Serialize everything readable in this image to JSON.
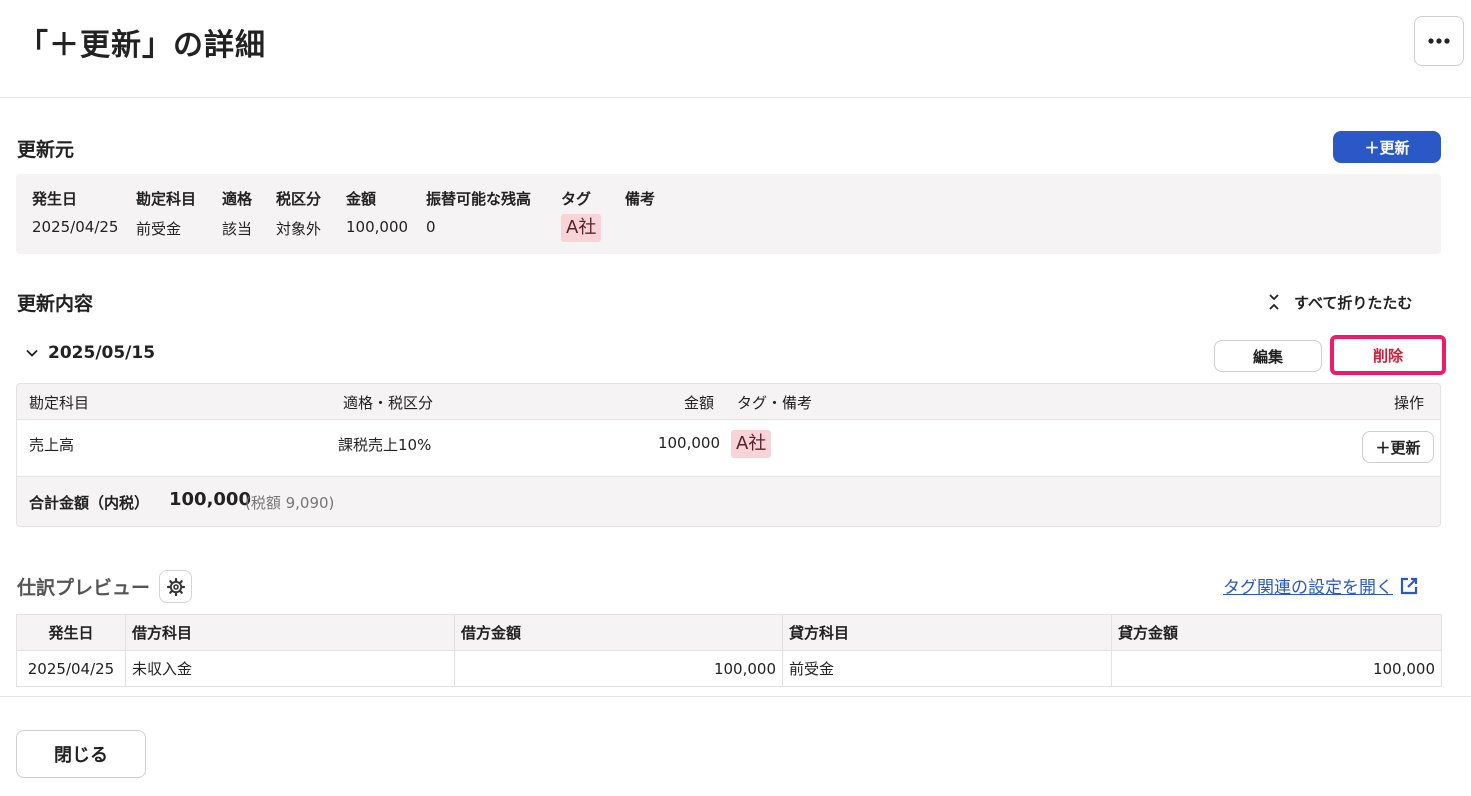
{
  "header": {
    "title": "「＋更新」の詳細"
  },
  "source": {
    "title": "更新元",
    "update_button": "＋更新",
    "columns": {
      "date": "発生日",
      "account": "勘定科目",
      "qualified": "適格",
      "tax_category": "税区分",
      "amount": "金額",
      "transferable_balance": "振替可能な残高",
      "tag": "タグ",
      "note": "備考"
    },
    "row": {
      "date": "2025/04/25",
      "account": "前受金",
      "qualified": "該当",
      "tax_category": "対象外",
      "amount": "100,000",
      "transferable_balance": "0",
      "tag": "A社",
      "note": ""
    }
  },
  "update_content": {
    "title": "更新内容",
    "collapse_all": "すべて折りたたむ",
    "group": {
      "date": "2025/05/15",
      "edit_button": "編集",
      "delete_button": "削除",
      "columns": {
        "account": "勘定科目",
        "qualified_tax": "適格・税区分",
        "amount": "金額",
        "tag_note": "タグ・備考",
        "action": "操作"
      },
      "row": {
        "account": "売上高",
        "qualified_tax": "課税売上10%",
        "amount": "100,000",
        "tag": "A社",
        "action_button": "＋更新"
      },
      "total": {
        "label": "合計金額（内税）",
        "value": "100,000",
        "tax_note": "(税額 9,090)"
      }
    }
  },
  "preview": {
    "title": "仕訳プレビュー",
    "tag_settings_link": "タグ関連の設定を開く",
    "columns": {
      "date": "発生日",
      "debit_account": "借方科目",
      "debit_amount": "借方金額",
      "credit_account": "貸方科目",
      "credit_amount": "貸方金額"
    },
    "rows": [
      {
        "date": "2025/04/25",
        "debit_account": "未収入金",
        "debit_amount": "100,000",
        "credit_account": "前受金",
        "credit_amount": "100,000"
      }
    ]
  },
  "footer": {
    "close_button": "閉じる"
  },
  "colors": {
    "primary": "#2a59c7",
    "danger_text": "#d11f3a",
    "highlight_border": "#f0196b",
    "tag_bg": "#f8d3d7"
  },
  "icons": {
    "more": "more-horizontal-icon",
    "collapse_all": "collapse-all-icon",
    "chevron": "chevron-down-icon",
    "gear": "gear-icon",
    "external_link": "external-link-icon"
  }
}
